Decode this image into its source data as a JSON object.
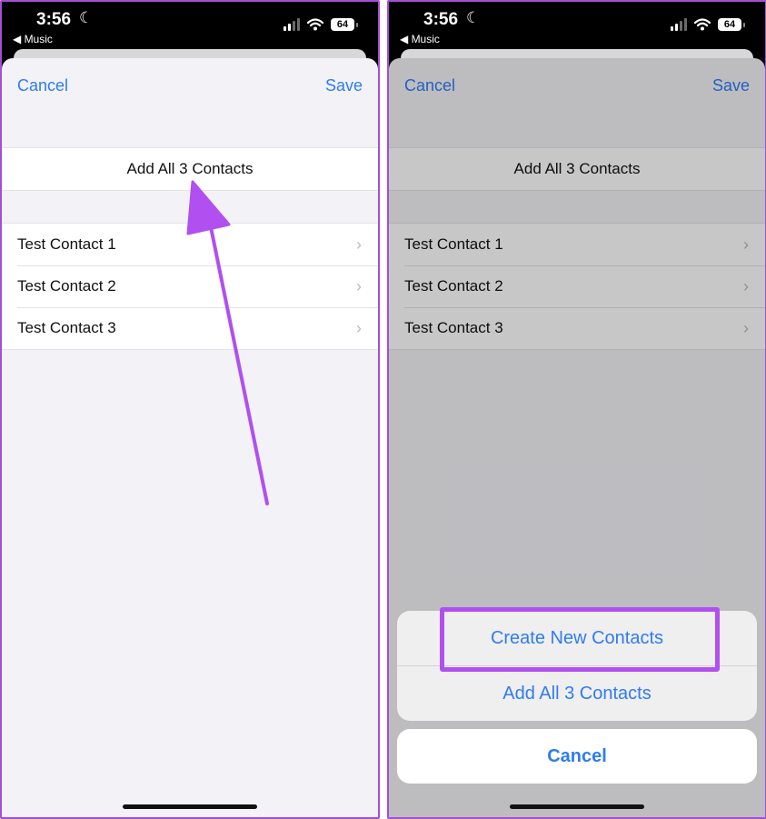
{
  "status_bar": {
    "time": "3:56",
    "back_label": "◀ Music",
    "battery": "64"
  },
  "left_screen": {
    "nav": {
      "cancel": "Cancel",
      "save": "Save"
    },
    "add_all": "Add All 3 Contacts",
    "contacts": [
      "Test Contact 1",
      "Test Contact 2",
      "Test Contact 3"
    ]
  },
  "right_screen": {
    "nav": {
      "cancel": "Cancel",
      "save": "Save"
    },
    "add_all": "Add All 3 Contacts",
    "contacts": [
      "Test Contact 1",
      "Test Contact 2",
      "Test Contact 3"
    ],
    "action_sheet": {
      "create_new": "Create New Contacts",
      "add_all": "Add All 3 Contacts",
      "cancel": "Cancel"
    }
  },
  "colors": {
    "accent_blue": "#2f7bf6",
    "annotation_purple": "#b24ff0"
  }
}
